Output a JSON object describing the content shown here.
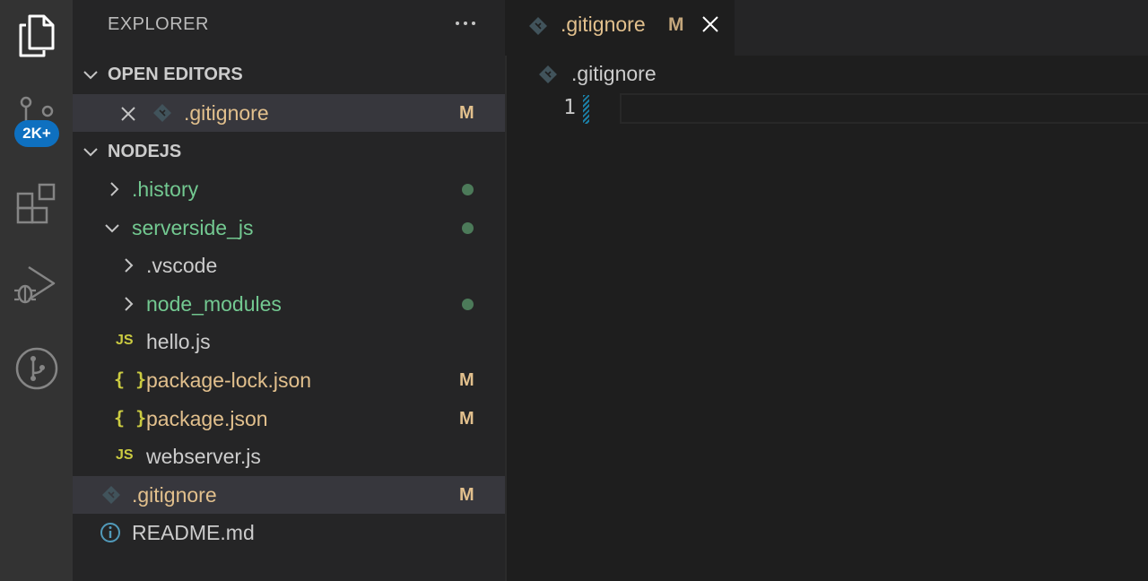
{
  "activity_bar": {
    "icons": [
      "files-icon",
      "source-control-icon",
      "extensions-icon",
      "run-debug-icon",
      "git-graph-icon"
    ],
    "source_control_badge": "2K+",
    "badge_color": "#0e70c0"
  },
  "sidebar": {
    "title": "EXPLORER",
    "open_editors": {
      "header": "OPEN EDITORS",
      "items": [
        {
          "label": ".gitignore",
          "status": "M"
        }
      ]
    },
    "workspace": {
      "header": "NODEJS",
      "items": [
        {
          "label": ".history",
          "kind": "folder",
          "expanded": false,
          "git": "dot"
        },
        {
          "label": "serverside_js",
          "kind": "folder",
          "expanded": true,
          "git": "dot"
        },
        {
          "label": ".vscode",
          "kind": "folder",
          "expanded": false,
          "git": ""
        },
        {
          "label": "node_modules",
          "kind": "folder",
          "expanded": false,
          "git": "dot"
        },
        {
          "label": "hello.js",
          "kind": "js",
          "icon_text": "JS",
          "git": ""
        },
        {
          "label": "package-lock.json",
          "kind": "json",
          "icon_text": "{ }",
          "status": "M"
        },
        {
          "label": "package.json",
          "kind": "json",
          "icon_text": "{ }",
          "status": "M"
        },
        {
          "label": "webserver.js",
          "kind": "js",
          "icon_text": "JS",
          "git": ""
        },
        {
          "label": ".gitignore",
          "kind": "git",
          "status": "M"
        },
        {
          "label": "README.md",
          "kind": "info",
          "git": ""
        }
      ]
    }
  },
  "editor": {
    "tab": {
      "label": ".gitignore",
      "status": "M"
    },
    "breadcrumb": ".gitignore",
    "line_numbers": [
      "1"
    ]
  },
  "colors": {
    "modified": "#e2c08d",
    "untracked_green": "#73c991",
    "selection": "#37373d"
  }
}
